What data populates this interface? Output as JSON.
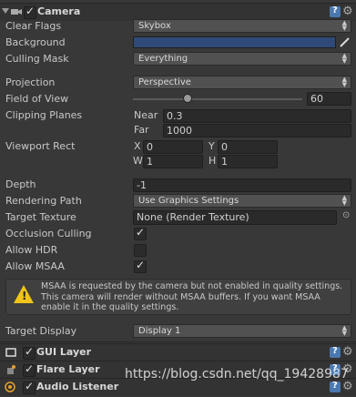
{
  "camera": {
    "title": "Camera",
    "enabled": true,
    "clear_flags": {
      "label": "Clear Flags",
      "value": "Skybox"
    },
    "background": {
      "label": "Background",
      "color": "#2f4a78"
    },
    "culling_mask": {
      "label": "Culling Mask",
      "value": "Everything"
    },
    "projection": {
      "label": "Projection",
      "value": "Perspective"
    },
    "fov": {
      "label": "Field of View",
      "value": "60"
    },
    "clipping": {
      "label": "Clipping Planes",
      "near_label": "Near",
      "near": "0.3",
      "far_label": "Far",
      "far": "1000"
    },
    "viewport": {
      "label": "Viewport Rect",
      "x_label": "X",
      "x": "0",
      "y_label": "Y",
      "y": "0",
      "w_label": "W",
      "w": "1",
      "h_label": "H",
      "h": "1"
    },
    "depth": {
      "label": "Depth",
      "value": "-1"
    },
    "rendering_path": {
      "label": "Rendering Path",
      "value": "Use Graphics Settings"
    },
    "target_texture": {
      "label": "Target Texture",
      "value": "None (Render Texture)"
    },
    "occlusion_culling": {
      "label": "Occlusion Culling",
      "checked": true
    },
    "allow_hdr": {
      "label": "Allow HDR",
      "checked": false
    },
    "allow_msaa": {
      "label": "Allow MSAA",
      "checked": true
    },
    "warning": "MSAA is requested by the camera but not enabled in quality settings. This camera will render without MSAA buffers. If you want MSAA enable it in the quality settings.",
    "target_display": {
      "label": "Target Display",
      "value": "Display 1"
    }
  },
  "components": [
    {
      "title": "GUI Layer",
      "enabled": true
    },
    {
      "title": "Flare Layer",
      "enabled": true
    },
    {
      "title": "Audio Listener",
      "enabled": true
    }
  ],
  "watermark": "https://blog.csdn.net/qq_19428987",
  "colors": {
    "panel": "#383838",
    "header": "#333333",
    "accent": "#4a78b0",
    "warning": "#f0c418",
    "background_swatch": "#2f4a78"
  }
}
